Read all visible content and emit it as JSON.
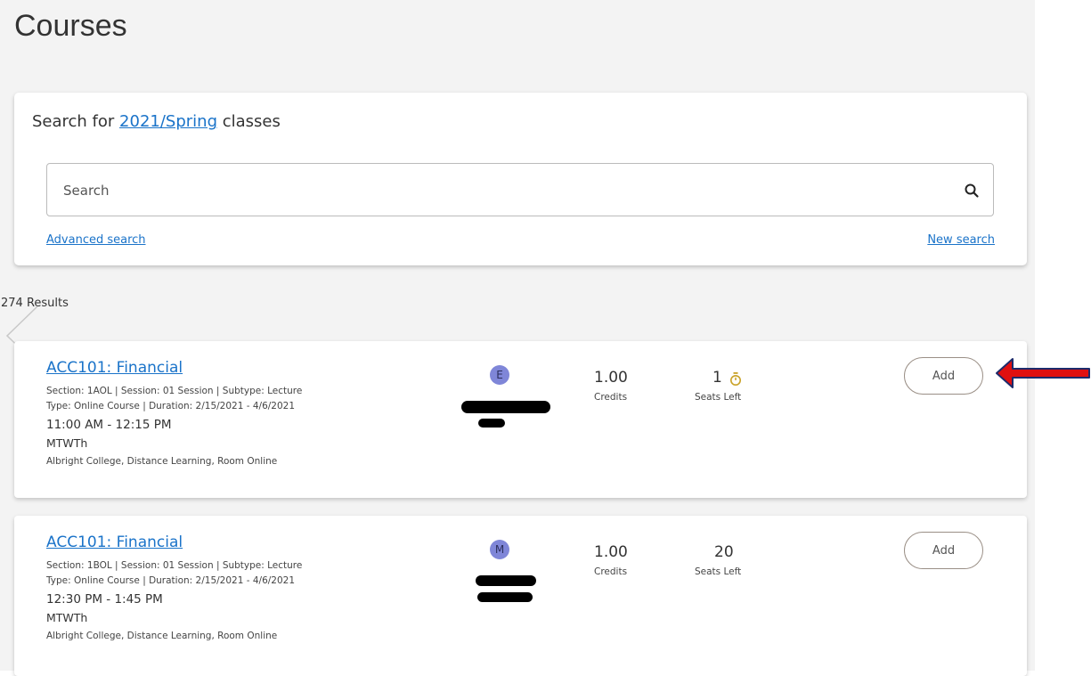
{
  "page": {
    "title": "Courses"
  },
  "search": {
    "heading_prefix": "Search for",
    "term": "2021/Spring",
    "heading_suffix": "classes",
    "placeholder": "Search",
    "advanced_label": "Advanced search",
    "new_label": "New search"
  },
  "results": {
    "count_label": "274 Results",
    "courses": [
      {
        "title": "ACC101: Financial",
        "section_line": "Section: 1AOL | Session: 01 Session | Subtype: Lecture",
        "type_line": "Type: Online Course | Duration: 2/15/2021 - 4/6/2021",
        "time": "11:00 AM - 12:15 PM",
        "days": "MTWTh",
        "location": "Albright College, Distance Learning, Room Online",
        "instructor_initial": "E",
        "credits": "1.00",
        "credits_label": "Credits",
        "seats": "1",
        "seats_label": "Seats Left",
        "seats_icon": "timer-icon",
        "add_label": "Add"
      },
      {
        "title": "ACC101: Financial",
        "section_line": "Section: 1BOL | Session: 01 Session | Subtype: Lecture",
        "type_line": "Type: Online Course | Duration: 2/15/2021 - 4/6/2021",
        "time": "12:30 PM - 1:45 PM",
        "days": "MTWTh",
        "location": "Albright College, Distance Learning, Room Online",
        "instructor_initial": "M",
        "credits": "1.00",
        "credits_label": "Credits",
        "seats": "20",
        "seats_label": "Seats Left",
        "add_label": "Add"
      }
    ]
  },
  "colors": {
    "link": "#1a73c9",
    "avatar": "#7f86d8",
    "timer": "#c9a227",
    "arrow": "#e01010",
    "arrow_outline": "#1d2b6b"
  }
}
